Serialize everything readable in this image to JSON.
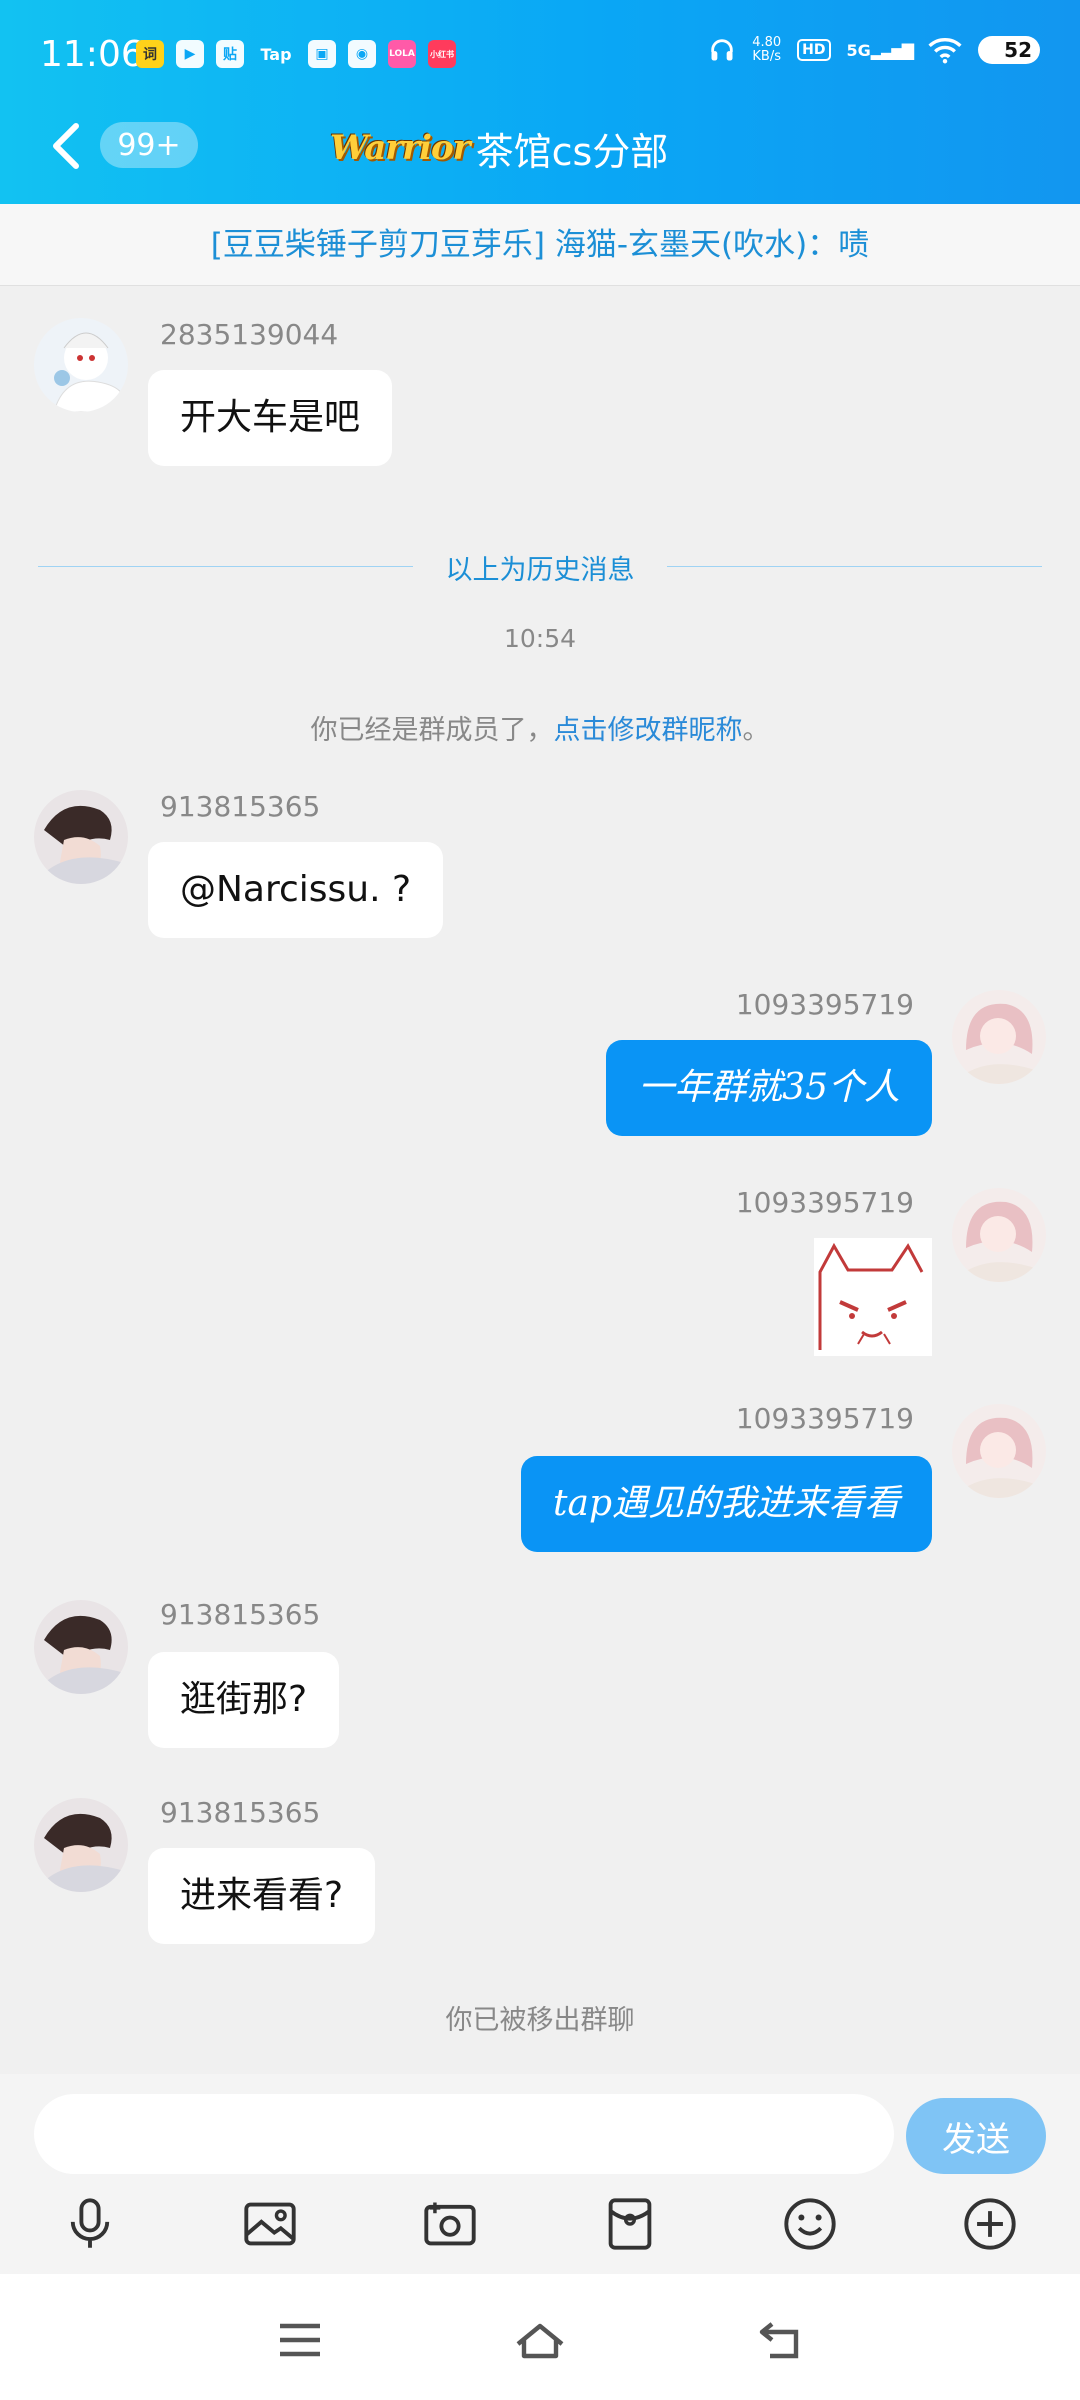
{
  "status_bar": {
    "time": "11:06",
    "app_icons": [
      "词",
      "▶",
      "贴",
      "Tap",
      "▣",
      "◉",
      "LOLA",
      "小红书"
    ],
    "net_speed_value": "4.80",
    "net_speed_unit": "KB/s",
    "hd": "HD",
    "signal": "5G",
    "battery": "52"
  },
  "header": {
    "unread_badge": "99+",
    "group_logo_text": "Warrior",
    "group_name": "茶馆cs分部"
  },
  "announcement": "[豆豆柴锤子剪刀豆芽乐] 海猫-玄墨天(吹水)：啧",
  "divider": {
    "label": "以上为历史消息"
  },
  "timestamp": "10:54",
  "system_message": {
    "text": "你已经是群成员了，",
    "link": "点击修改群昵称",
    "suffix": "。"
  },
  "messages": [
    {
      "sender": "2835139044",
      "text": "开大车是吧"
    },
    {
      "sender": "913815365",
      "text": "@Narcissu. ?"
    },
    {
      "sender": "1093395719",
      "text": "一年群就35个人"
    },
    {
      "sender": "1093395719",
      "text": ""
    },
    {
      "sender": "1093395719",
      "text": "tap遇见的我进来看看"
    },
    {
      "sender": "913815365",
      "text": "逛街那?"
    },
    {
      "sender": "913815365",
      "text": "进来看看?"
    }
  ],
  "removed_notice": "你已被移出群聊",
  "input": {
    "placeholder": "",
    "send_label": "发送"
  },
  "toolbar_icons": [
    "mic-icon",
    "image-icon",
    "camera-icon",
    "red-packet-icon",
    "emoji-icon",
    "plus-icon"
  ],
  "nav_icons": [
    "menu-icon",
    "home-icon",
    "back-icon"
  ],
  "colors": {
    "header": "#0aa7f5",
    "bubble_right": "#0a94f5",
    "link": "#1c8fd6",
    "send_button": "#7fc4f5"
  }
}
